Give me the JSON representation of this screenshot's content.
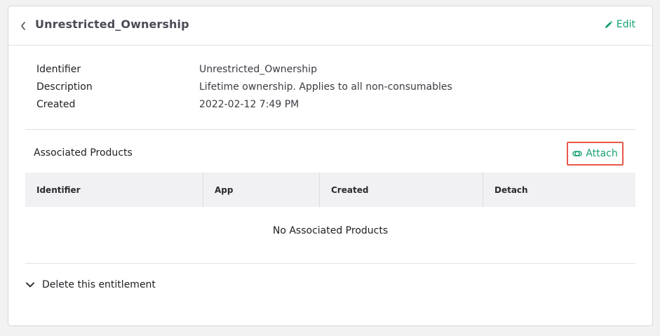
{
  "header": {
    "title": "Unrestricted_Ownership",
    "edit_label": "Edit"
  },
  "details": [
    {
      "label": "Identifier",
      "value": "Unrestricted_Ownership"
    },
    {
      "label": "Description",
      "value": "Lifetime ownership. Applies to all non-consumables"
    },
    {
      "label": "Created",
      "value": "2022-02-12 7:49 PM"
    }
  ],
  "associated_products": {
    "title": "Associated Products",
    "attach_label": "Attach",
    "columns": [
      "Identifier",
      "App",
      "Created",
      "Detach"
    ],
    "empty_message": "No Associated Products"
  },
  "danger_zone": {
    "label": "Delete this entitlement"
  },
  "colors": {
    "accent": "#15a06f",
    "highlight_border": "#e8584a"
  }
}
